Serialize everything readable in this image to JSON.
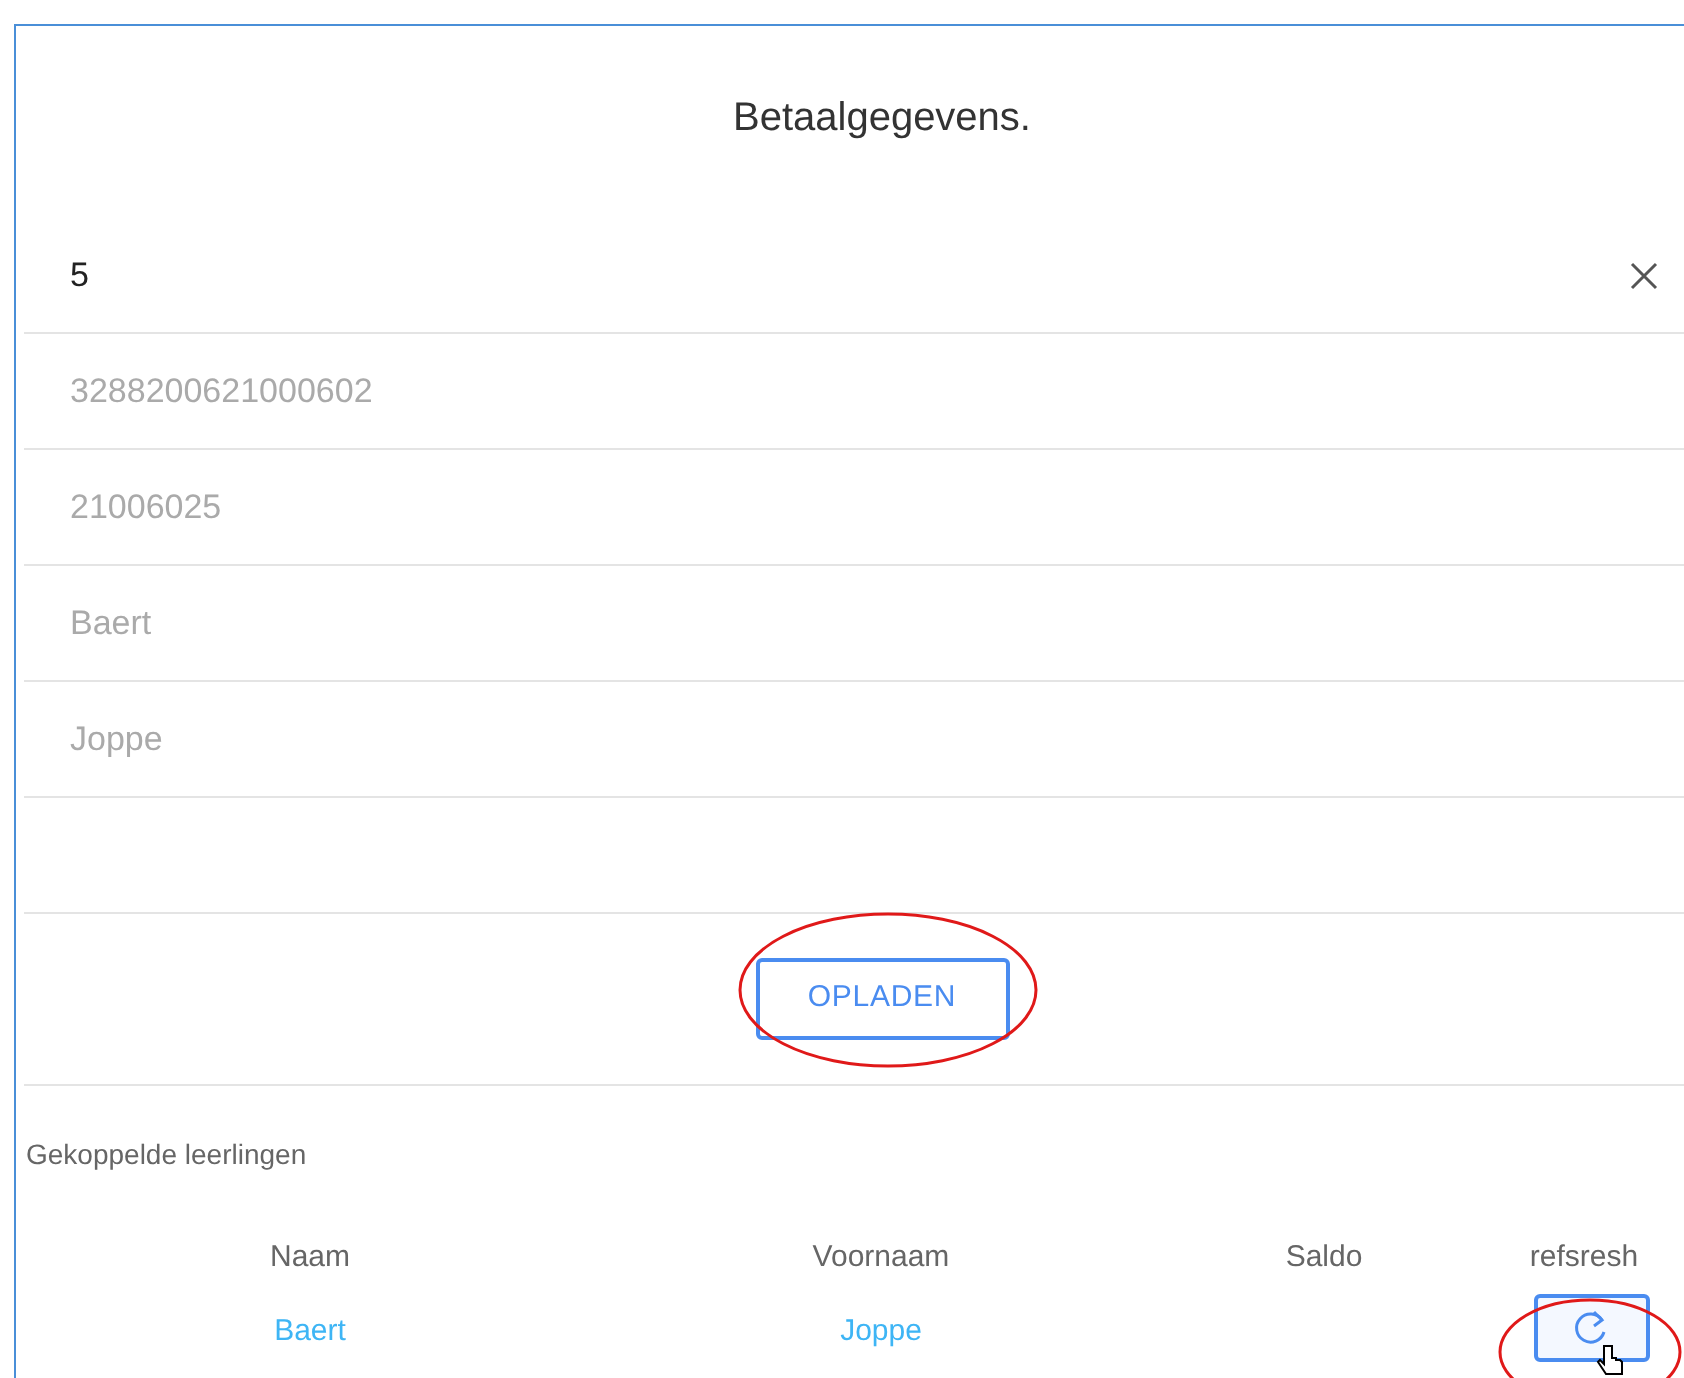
{
  "dialog": {
    "title": "Betaalgegevens."
  },
  "fields": [
    {
      "value": "5",
      "clearable": true
    },
    {
      "placeholder": "3288200621000602",
      "clearable": false
    },
    {
      "placeholder": "21006025",
      "clearable": false
    },
    {
      "placeholder": "Baert",
      "clearable": false
    },
    {
      "placeholder": "Joppe",
      "clearable": false
    },
    {
      "clearable": false
    }
  ],
  "upload_button": {
    "label": "OPLADEN"
  },
  "linked_students": {
    "heading": "Gekoppelde leerlingen",
    "columns": [
      "Naam",
      "Voornaam",
      "Saldo",
      "refsresh"
    ],
    "rows": [
      {
        "naam": "Baert",
        "voornaam": "Joppe"
      }
    ]
  }
}
